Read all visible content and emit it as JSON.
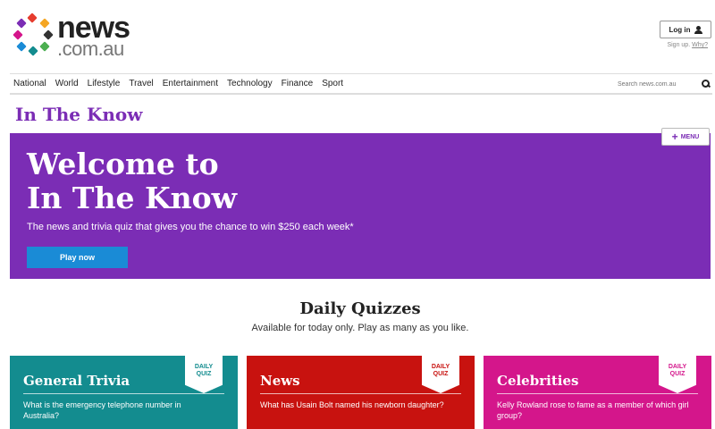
{
  "header": {
    "logo": {
      "word1": "news",
      "word2": ".com.au"
    },
    "login_label": "Log in",
    "signup_label": "Sign up.",
    "why_label": "Why?"
  },
  "nav": {
    "items": [
      "National",
      "World",
      "Lifestyle",
      "Travel",
      "Entertainment",
      "Technology",
      "Finance",
      "Sport"
    ],
    "search_placeholder": "Search news.com.au"
  },
  "section_title": "In The Know",
  "menu_label": "MENU",
  "hero": {
    "title_line1": "Welcome to",
    "title_line2": "In The Know",
    "subtitle": "The news and trivia quiz that gives you the chance to win $250 each week*",
    "play_label": "Play now",
    "background_color": "#7b2db5",
    "button_color": "#1a8bd6"
  },
  "daily": {
    "title": "Daily Quizzes",
    "subtitle": "Available for today only. Play as many as you like."
  },
  "cards": [
    {
      "title": "General Trivia",
      "badge_line1": "DAILY",
      "badge_line2": "QUIZ",
      "question": "What is the emergency telephone number in Australia?",
      "color": "#138c8f"
    },
    {
      "title": "News",
      "badge_line1": "DAILY",
      "badge_line2": "QUIZ",
      "question": "What has Usain Bolt named his newborn daughter?",
      "color": "#c8120f"
    },
    {
      "title": "Celebrities",
      "badge_line1": "DAILY",
      "badge_line2": "QUIZ",
      "question": "Kelly Rowland rose to fame as a member of which girl group?",
      "color": "#d4168b"
    }
  ],
  "icons": {
    "logo_dots": "logo-dots-icon",
    "user": "user-icon",
    "search": "search-icon",
    "plus": "plus-icon"
  }
}
